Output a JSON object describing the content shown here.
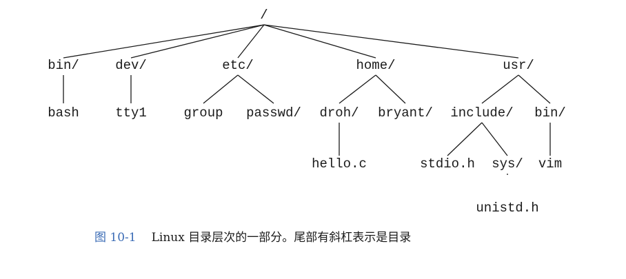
{
  "diagram": {
    "nodes": {
      "root": "/",
      "bin": "bin/",
      "dev": "dev/",
      "etc": "etc/",
      "home": "home/",
      "usr": "usr/",
      "bash": "bash",
      "tty1": "tty1",
      "group": "group",
      "passwd": "passwd/",
      "droh": "droh/",
      "bryant": "bryant/",
      "include": "include/",
      "usr_bin": "bin/",
      "hello": "hello.c",
      "stdio": "stdio.h",
      "sys": "sys/",
      "vim": "vim",
      "unistd": "unistd.h"
    },
    "edges": [
      [
        "root",
        "bin"
      ],
      [
        "root",
        "dev"
      ],
      [
        "root",
        "etc"
      ],
      [
        "root",
        "home"
      ],
      [
        "root",
        "usr"
      ],
      [
        "bin",
        "bash"
      ],
      [
        "dev",
        "tty1"
      ],
      [
        "etc",
        "group"
      ],
      [
        "etc",
        "passwd"
      ],
      [
        "home",
        "droh"
      ],
      [
        "home",
        "bryant"
      ],
      [
        "usr",
        "include"
      ],
      [
        "usr",
        "usr_bin"
      ],
      [
        "droh",
        "hello"
      ],
      [
        "include",
        "stdio"
      ],
      [
        "include",
        "sys"
      ],
      [
        "usr_bin",
        "vim"
      ],
      [
        "sys",
        "unistd"
      ]
    ]
  },
  "caption": {
    "figure_number": "图 10-1",
    "text": "Linux 目录层次的一部分。尾部有斜杠表示是目录"
  },
  "colors": {
    "caption_number": "#3a6bb5",
    "ink": "#1a1a1a"
  }
}
